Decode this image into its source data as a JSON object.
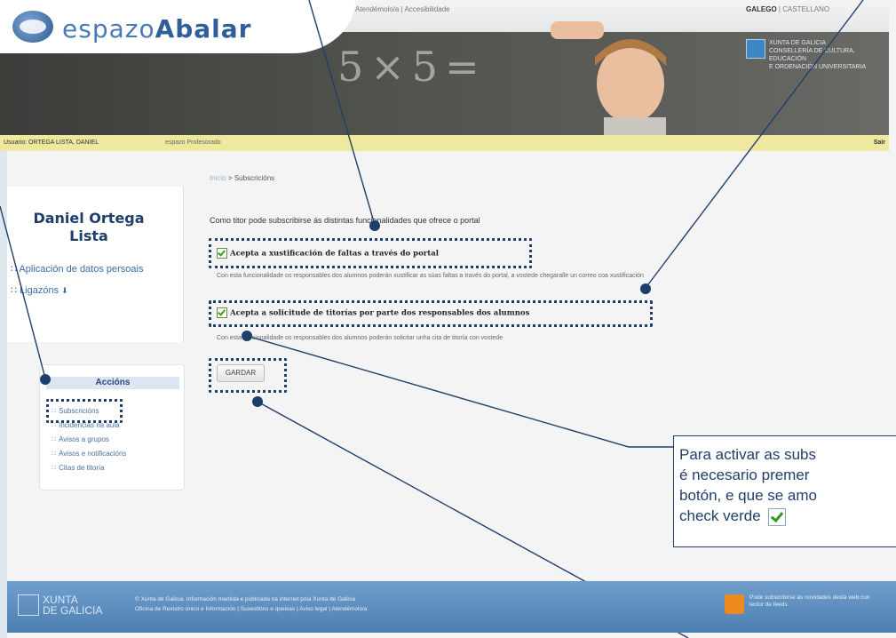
{
  "header": {
    "logo_prefix": "espazo",
    "logo_bold": "Abalar",
    "top_links": "Atendémolo/a | Accesibilidade",
    "lang_gl": "GALEGO",
    "lang_sep": "|",
    "lang_es": "CASTELLANO",
    "xunta_title": "XUNTA DE GALICIA",
    "xunta_sub1": "CONSELLERÍA DE CULTURA, EDUCACIÓN",
    "xunta_sub2": "E ORDENACIÓN UNIVERSITARIA",
    "chalk_text": "5×5=",
    "user_label": "Usuario: ORTEGA LISTA, DANIEL",
    "space_label": "espazo Profesorado",
    "logout": "Saír"
  },
  "sidebar": {
    "user_name": "Daniel Ortega Lista",
    "links": [
      "Aplicación de datos persoais",
      "Ligazóns"
    ],
    "actions_title": "Accións",
    "actions": [
      "Subscricións",
      "Incidencias na aula",
      "Avisos a grupos",
      "Avisos e notificacións",
      "Citas de titoría"
    ]
  },
  "main": {
    "breadcrumb_home": "Inicio",
    "breadcrumb_sep": ">",
    "breadcrumb_current": "Subscricións",
    "intro": "Como titor pode subscribirse ás distintas funcionalidades que ofrece o portal",
    "option1_label": "Acepta a xustificación de faltas a través do portal",
    "option1_desc": "Con esta funcionalidade os responsables dos alumnos poderán xustificar as súas faltas a través do portal, a vostede chegaralle un correo coa xustificación",
    "option2_label": "Acepta a solicitude de titorías por parte dos responsables dos alumnos",
    "option2_desc": "Con esta funcionalidade os responsables dos alumnos poderán solicitar unha cita de titoría con vostede",
    "save_button": "GARDAR"
  },
  "callout": {
    "line1": "Para activar as subs",
    "line2": "é necesario premer",
    "line3": "botón, e que se amo",
    "line4": "check verde"
  },
  "footer": {
    "xunta_line1": "XUNTA",
    "xunta_line2": "DE GALICIA",
    "text1": "© Xunta de Galicia. Información mantida e publicada na internet pola Xunta de Galicia",
    "text2": "Oficina de Rexistro único e Información | Suxestións e queixas | Aviso legal | Atendémolo/a",
    "rss_text": "Pode subscribirse ás novidades desta web cun lector de feeds"
  },
  "colors": {
    "annotation": "#1f3f6b",
    "footer": "#5a8bbd",
    "userbar": "#efe9a0"
  }
}
